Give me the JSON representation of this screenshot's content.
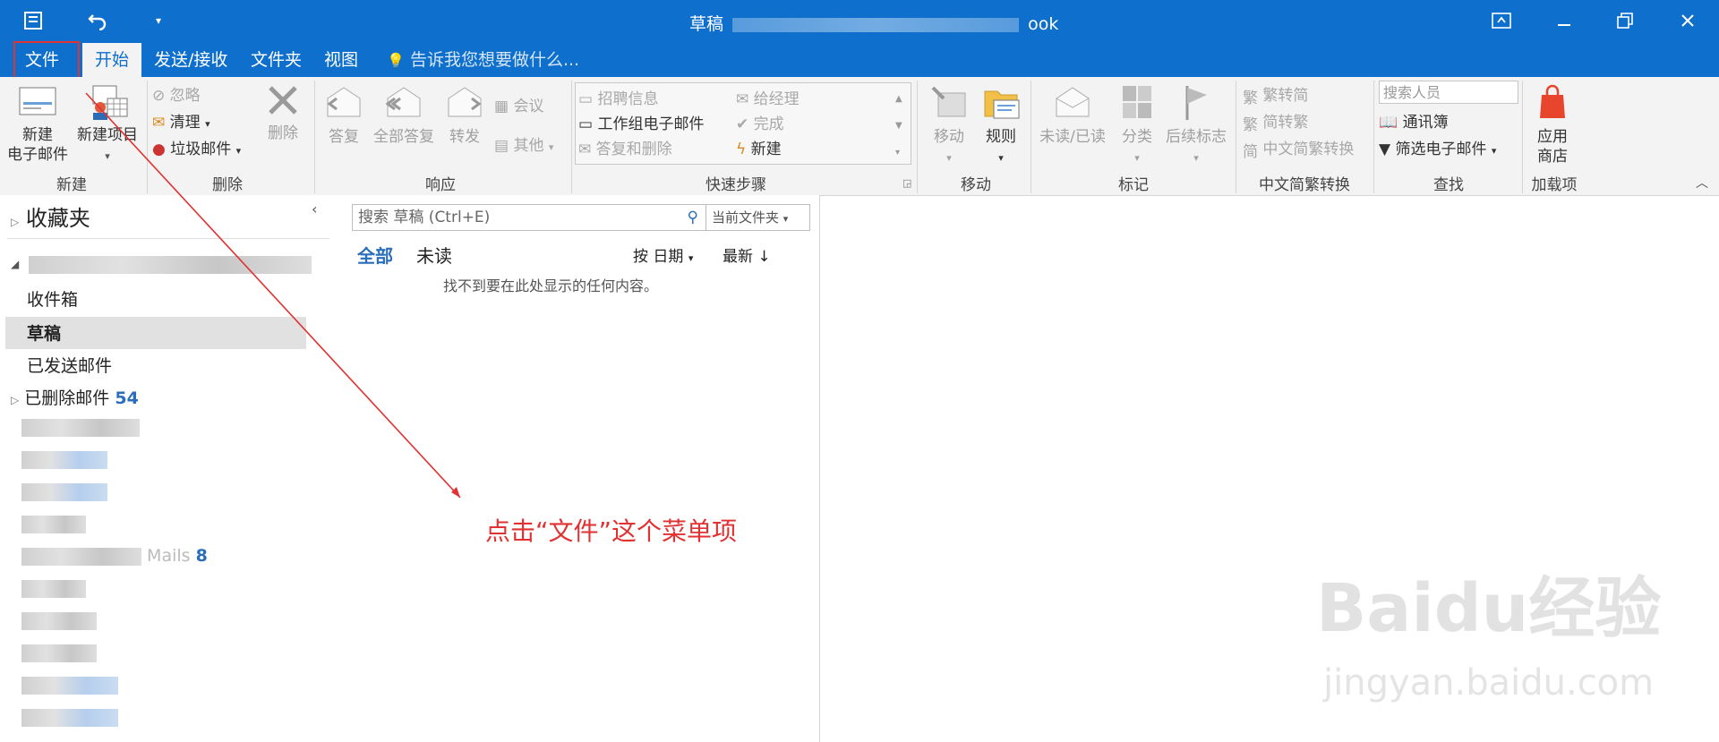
{
  "titlebar": {
    "title_prefix": "草稿",
    "title_suffix": "ook",
    "undo_icon": "undo-icon",
    "qat_icon": "customize-quick-access-icon",
    "ribbon_display_icon": "ribbon-display-options-icon",
    "minimize_icon": "minimize-icon",
    "restore_icon": "restore-icon",
    "close_icon": "close-icon"
  },
  "tabs": [
    "文件",
    "开始",
    "发送/接收",
    "文件夹",
    "视图"
  ],
  "tell_me": "告诉我您想要做什么...",
  "ribbon": {
    "new_group": {
      "label": "新建",
      "new_email_1": "新建",
      "new_email_2": "电子邮件",
      "new_items": "新建项目"
    },
    "delete_group": {
      "label": "删除",
      "ignore": "忽略",
      "cleanup": "清理",
      "junk": "垃圾邮件",
      "delete": "删除"
    },
    "respond_group": {
      "label": "响应",
      "reply": "答复",
      "reply_all": "全部答复",
      "forward": "转发",
      "meeting": "会议",
      "more": "其他"
    },
    "quicksteps_group": {
      "label": "快速步骤",
      "items": [
        "招聘信息",
        "给经理",
        "工作组电子邮件",
        "完成",
        "答复和删除",
        "新建"
      ]
    },
    "move_group": {
      "label": "移动",
      "move": "移动",
      "rules": "规则"
    },
    "tags_group": {
      "label": "标记",
      "unread_read": "未读/已读",
      "categorize": "分类",
      "followup": "后续标志"
    },
    "chinese_group": {
      "label": "中文简繁转换",
      "to_simplified": "繁转简",
      "to_traditional": "简转繁",
      "convert": "中文简繁转换"
    },
    "find_group": {
      "label": "查找",
      "search_people_placeholder": "搜索人员",
      "address_book": "通讯簿",
      "filter_email": "筛选电子邮件"
    },
    "addins_group": {
      "label": "加载项",
      "store_1": "应用",
      "store_2": "商店"
    }
  },
  "sidebar": {
    "favorites": "收藏夹",
    "folders": [
      "收件箱",
      "草稿",
      "已发送邮件",
      "已删除邮件"
    ],
    "deleted_count": "54",
    "mails_suffix": "Mails",
    "mails_count": "8"
  },
  "list": {
    "search_placeholder": "搜索 草稿 (Ctrl+E)",
    "scope": "当前文件夹",
    "filter_all": "全部",
    "filter_unread": "未读",
    "sort_by": "按 日期",
    "order": "最新 ↓",
    "empty_message": "找不到要在此处显示的任何内容。"
  },
  "annotation": "点击“文件”这个菜单项",
  "watermark": {
    "main": "Baidu经验",
    "sub": "jingyan.baidu.com"
  },
  "colors": {
    "accent": "#0e6fcd",
    "annotation": "#e03232"
  }
}
